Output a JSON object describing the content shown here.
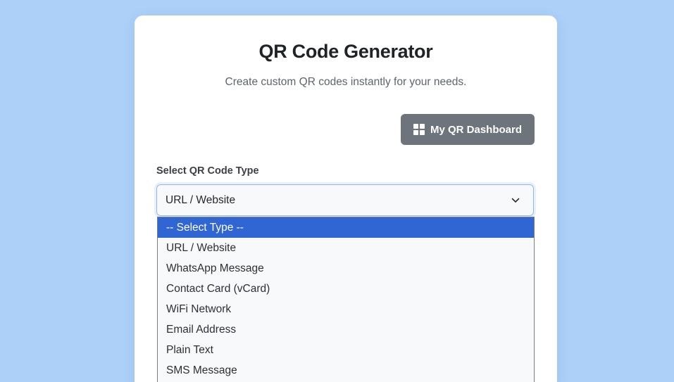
{
  "card": {
    "title": "QR Code Generator",
    "subtitle": "Create custom QR codes instantly for your needs.",
    "dashboard_button": {
      "label": "My QR Dashboard",
      "icon": "windows-grid-icon"
    },
    "type_field": {
      "label": "Select QR Code Type",
      "value": "URL / Website",
      "icon": "chevron-down-icon"
    }
  },
  "dropdown": {
    "highlighted_index": 0,
    "options": [
      "-- Select Type --",
      "URL / Website",
      "WhatsApp Message",
      "Contact Card (vCard)",
      "WiFi Network",
      "Email Address",
      "Plain Text",
      "SMS Message"
    ]
  },
  "colors": {
    "background": "#acd0f7",
    "card": "#ffffff",
    "button": "#6d747c",
    "highlight": "#2f66d4",
    "focus_border": "#8fbaf0"
  }
}
